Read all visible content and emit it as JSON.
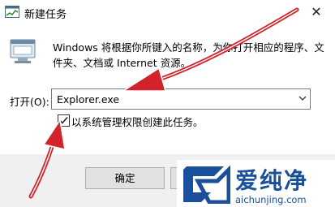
{
  "window": {
    "title": "新建任务",
    "close_glyph": "✕"
  },
  "dialog": {
    "description": "Windows 将根据你所键入的名称，为你打开相应的程序、文件夹、文档或 Internet 资源。",
    "open_label": "打开(O):",
    "open_value": "Explorer.exe",
    "admin_checked": true,
    "admin_label": "以系统管理权限创建此任务。",
    "ok_label": "确定"
  },
  "watermark": {
    "brand": "爱纯净",
    "site": "aichunjing.com"
  },
  "icons": {
    "app": "task-manager-icon",
    "run": "run-program-icon",
    "dropdown": "chevron-down-icon",
    "check": "checkmark-icon",
    "logo": "aichunjing-logo-icon"
  },
  "colors": {
    "annotation_arrow": "#d2232a",
    "watermark_blue": "#1a4f9c"
  }
}
